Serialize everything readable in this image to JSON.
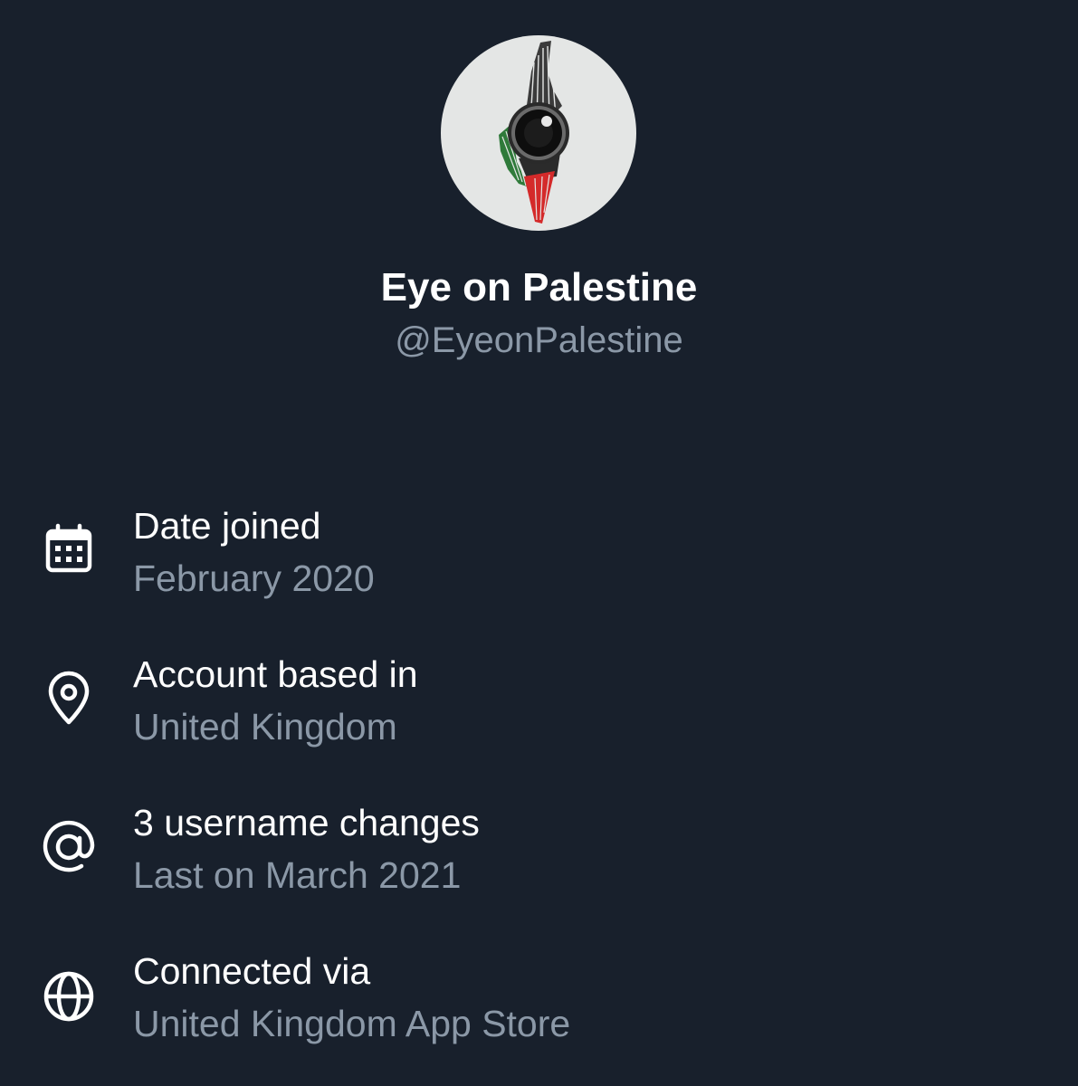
{
  "profile": {
    "display_name": "Eye on Palestine",
    "handle": "@EyeonPalestine"
  },
  "about": [
    {
      "icon": "calendar-icon",
      "title": "Date joined",
      "value": "February 2020"
    },
    {
      "icon": "location-pin-icon",
      "title": "Account based in",
      "value": "United Kingdom"
    },
    {
      "icon": "at-sign-icon",
      "title": "3 username changes",
      "value": "Last on March 2021"
    },
    {
      "icon": "globe-icon",
      "title": "Connected via",
      "value": "United Kingdom App Store"
    }
  ],
  "colors": {
    "background": "#18202c",
    "primary_text": "#ffffff",
    "secondary_text": "#8b98a7",
    "avatar_background": "#e4e6e5"
  }
}
